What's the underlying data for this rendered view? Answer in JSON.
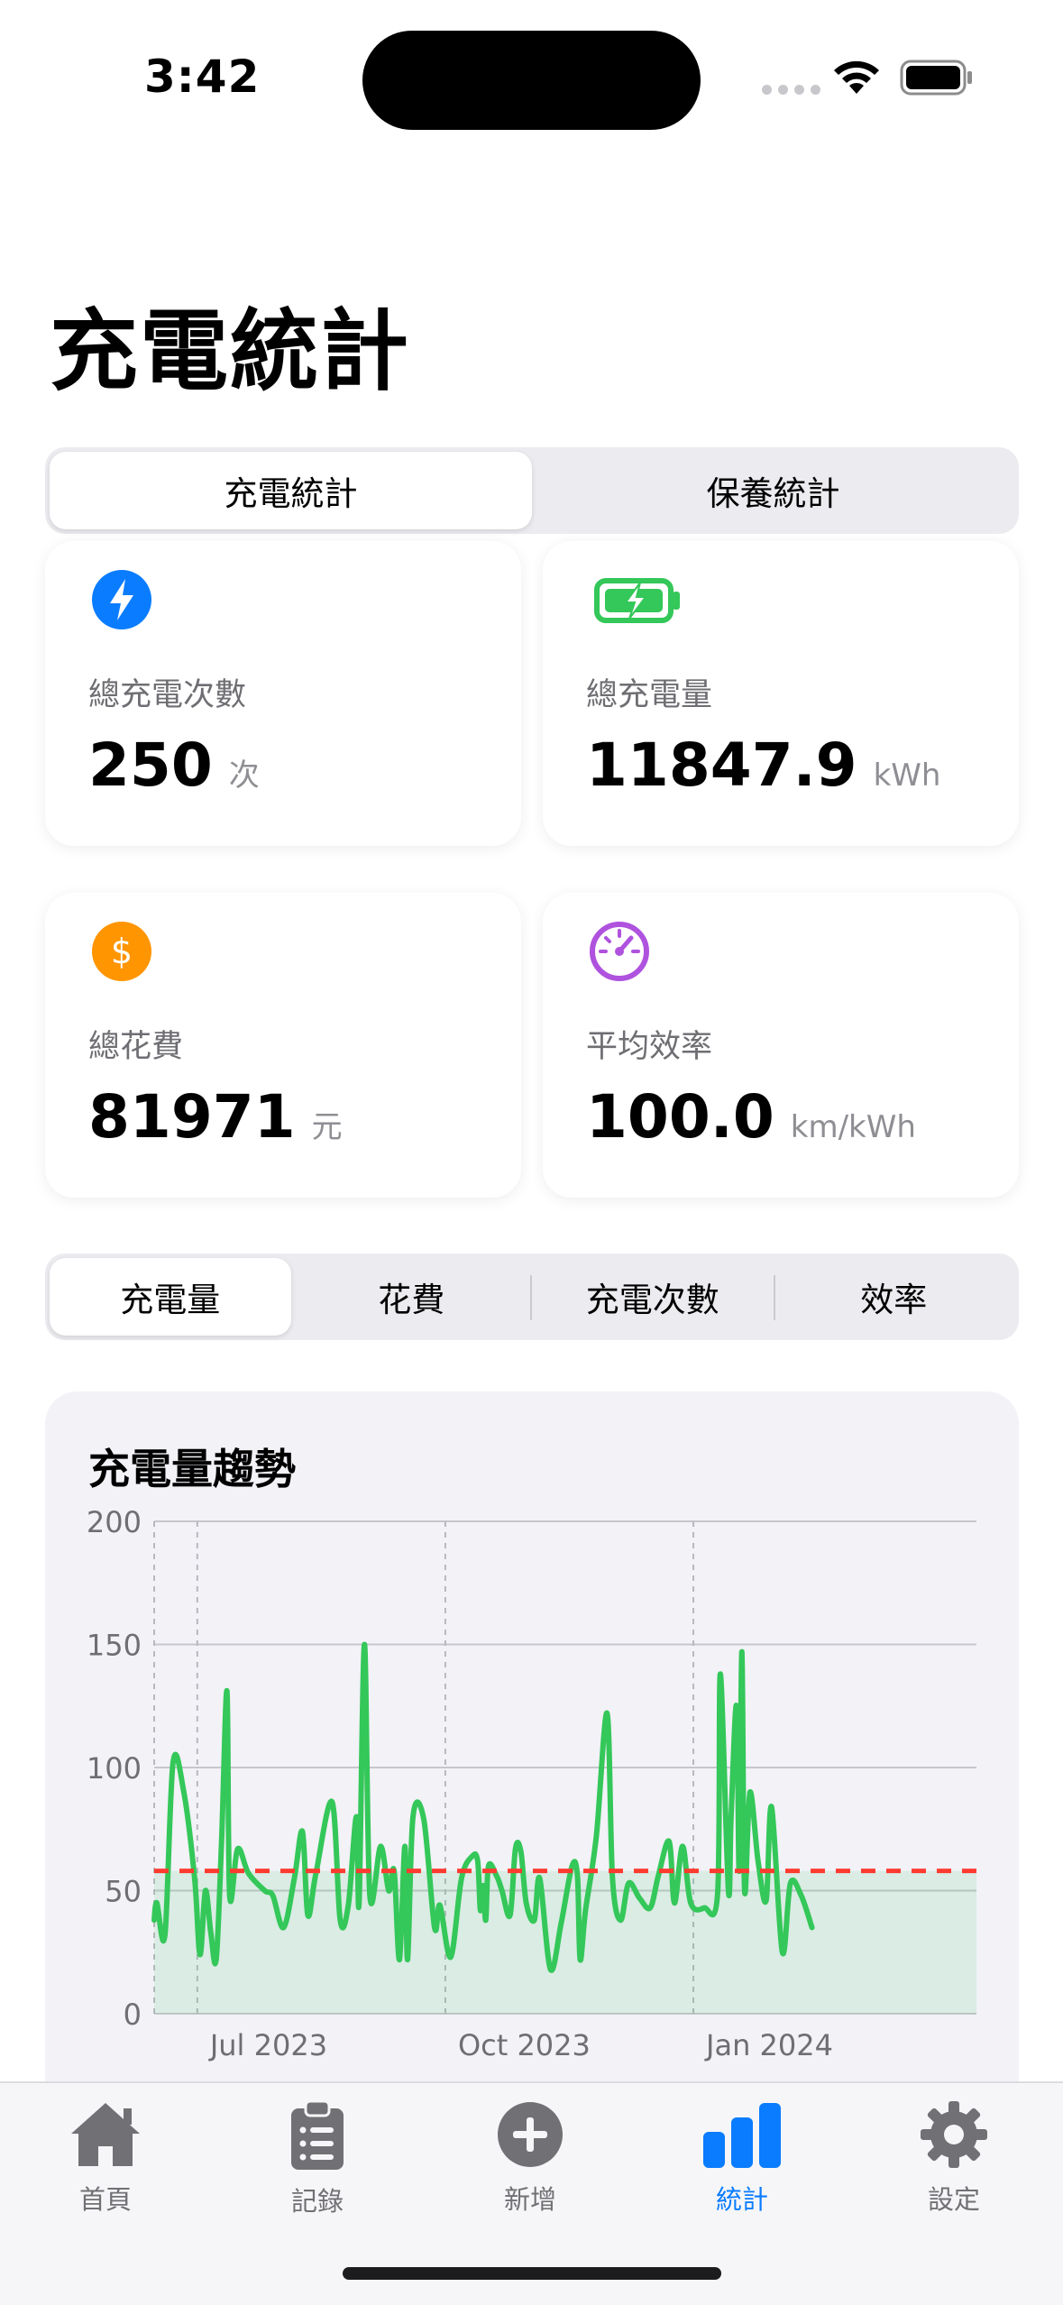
{
  "status_bar": {
    "time": "3:42"
  },
  "page": {
    "title": "充電統計"
  },
  "top_segment": {
    "items": [
      "充電統計",
      "保養統計"
    ],
    "selected": 0
  },
  "stats": [
    {
      "icon": "lightning-icon",
      "label": "總充電次數",
      "value": "250",
      "unit": "次",
      "color": "#0a7cff"
    },
    {
      "icon": "battery-charging-icon",
      "label": "總充電量",
      "value": "11847.9",
      "unit": "kWh",
      "color": "#34c759"
    },
    {
      "icon": "dollar-icon",
      "label": "總花費",
      "value": "81971",
      "unit": "元",
      "color": "#ff9500"
    },
    {
      "icon": "gauge-icon",
      "label": "平均效率",
      "value": "100.0",
      "unit": "km/kWh",
      "color": "#af52de"
    }
  ],
  "metric_segment": {
    "items": [
      "充電量",
      "花費",
      "充電次數",
      "效率"
    ],
    "selected": 0
  },
  "chart_data": {
    "type": "area",
    "title": "充電量趨勢",
    "xlabel": "",
    "ylabel": "",
    "ylim": [
      0,
      200
    ],
    "y_ticks": [
      "0",
      "50",
      "100",
      "150",
      "200"
    ],
    "x_ticks": [
      "Jul 2023",
      "Oct 2023",
      "Jan 2024"
    ],
    "x_range": [
      "2023-06-15",
      "2024-04-15"
    ],
    "grid": true,
    "line_color": "#34c759",
    "average_line": {
      "value": 58,
      "color": "#ff3b30",
      "style": "dashed"
    },
    "series": [
      {
        "values": [
          [
            "2023-06-15",
            38
          ],
          [
            "2023-06-16",
            45
          ],
          [
            "2023-06-19",
            32
          ],
          [
            "2023-06-22",
            102
          ],
          [
            "2023-06-26",
            90
          ],
          [
            "2023-06-30",
            55
          ],
          [
            "2023-07-02",
            24
          ],
          [
            "2023-07-04",
            50
          ],
          [
            "2023-07-06",
            33
          ],
          [
            "2023-07-08",
            22
          ],
          [
            "2023-07-10",
            70
          ],
          [
            "2023-07-12",
            131
          ],
          [
            "2023-07-13",
            48
          ],
          [
            "2023-07-16",
            67
          ],
          [
            "2023-07-20",
            57
          ],
          [
            "2023-07-26",
            50
          ],
          [
            "2023-07-29",
            48
          ],
          [
            "2023-08-02",
            35
          ],
          [
            "2023-08-06",
            55
          ],
          [
            "2023-08-09",
            74
          ],
          [
            "2023-08-11",
            40
          ],
          [
            "2023-08-14",
            57
          ],
          [
            "2023-08-20",
            86
          ],
          [
            "2023-08-23",
            38
          ],
          [
            "2023-08-26",
            44
          ],
          [
            "2023-08-29",
            80
          ],
          [
            "2023-08-30",
            45
          ],
          [
            "2023-09-01",
            150
          ],
          [
            "2023-09-03",
            48
          ],
          [
            "2023-09-07",
            68
          ],
          [
            "2023-09-10",
            50
          ],
          [
            "2023-09-12",
            58
          ],
          [
            "2023-09-14",
            22
          ],
          [
            "2023-09-16",
            68
          ],
          [
            "2023-09-17",
            22
          ],
          [
            "2023-09-19",
            80
          ],
          [
            "2023-09-23",
            79
          ],
          [
            "2023-09-27",
            35
          ],
          [
            "2023-09-29",
            44
          ],
          [
            "2023-10-03",
            23
          ],
          [
            "2023-10-07",
            55
          ],
          [
            "2023-10-11",
            64
          ],
          [
            "2023-10-13",
            62
          ],
          [
            "2023-10-14",
            42
          ],
          [
            "2023-10-15",
            52
          ],
          [
            "2023-10-16",
            38
          ],
          [
            "2023-10-17",
            60
          ],
          [
            "2023-10-20",
            56
          ],
          [
            "2023-10-22",
            50
          ],
          [
            "2023-10-25",
            40
          ],
          [
            "2023-10-27",
            67
          ],
          [
            "2023-10-29",
            66
          ],
          [
            "2023-10-31",
            45
          ],
          [
            "2023-11-03",
            38
          ],
          [
            "2023-11-05",
            55
          ],
          [
            "2023-11-09",
            18
          ],
          [
            "2023-11-13",
            37
          ],
          [
            "2023-11-17",
            60
          ],
          [
            "2023-11-19",
            56
          ],
          [
            "2023-11-20",
            22
          ],
          [
            "2023-11-22",
            42
          ],
          [
            "2023-11-26",
            72
          ],
          [
            "2023-11-30",
            122
          ],
          [
            "2023-12-02",
            55
          ],
          [
            "2023-12-05",
            38
          ],
          [
            "2023-12-08",
            53
          ],
          [
            "2023-12-12",
            47
          ],
          [
            "2023-12-16",
            43
          ],
          [
            "2023-12-19",
            56
          ],
          [
            "2023-12-23",
            70
          ],
          [
            "2023-12-25",
            45
          ],
          [
            "2023-12-28",
            68
          ],
          [
            "2023-12-31",
            45
          ],
          [
            "2024-01-05",
            43
          ],
          [
            "2024-01-10",
            49
          ],
          [
            "2024-01-11",
            138
          ],
          [
            "2024-01-14",
            50
          ],
          [
            "2024-01-15",
            80
          ],
          [
            "2024-01-17",
            125
          ],
          [
            "2024-01-18",
            58
          ],
          [
            "2024-01-19",
            147
          ],
          [
            "2024-01-20",
            50
          ],
          [
            "2024-01-22",
            90
          ],
          [
            "2024-01-25",
            62
          ],
          [
            "2024-01-28",
            46
          ],
          [
            "2024-01-30",
            84
          ],
          [
            "2024-02-03",
            25
          ],
          [
            "2024-02-06",
            53
          ],
          [
            "2024-02-10",
            48
          ],
          [
            "2024-02-14",
            35
          ]
        ]
      }
    ]
  },
  "tab_bar": {
    "items": [
      {
        "icon": "home-icon",
        "label": "首頁"
      },
      {
        "icon": "clipboard-icon",
        "label": "記錄"
      },
      {
        "icon": "plus-circle-icon",
        "label": "新增"
      },
      {
        "icon": "chart-bars-icon",
        "label": "統計"
      },
      {
        "icon": "gear-icon",
        "label": "設定"
      }
    ],
    "selected": 3,
    "active_color": "#0a7cff",
    "inactive_color": "#707075"
  }
}
